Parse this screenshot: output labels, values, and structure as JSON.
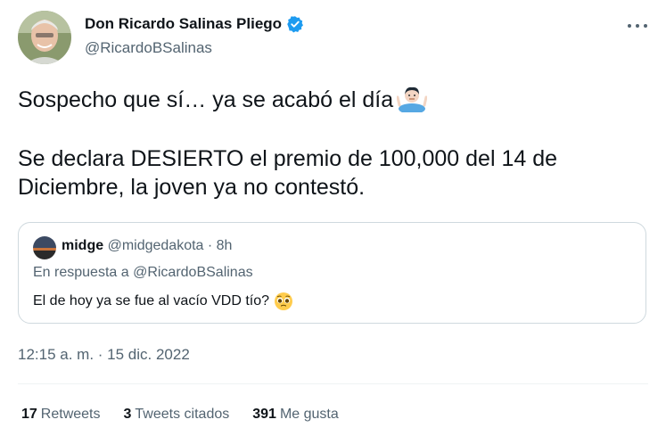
{
  "tweet": {
    "author_name": "Don Ricardo Salinas Pliego",
    "author_handle": "@RicardoBSalinas",
    "verified": true,
    "paragraph_1": "Sospecho que sí… ya se acabó el día",
    "paragraph_2": "Se declara DESIERTO el premio de 100,000 del 14 de Diciembre, la joven ya no contestó.",
    "timestamp": "12:15 a. m. · 15 dic. 2022"
  },
  "quoted": {
    "name": "midge",
    "handle_time": "@midgedakota · 8h",
    "reply_to": "En respuesta a @RicardoBSalinas",
    "text": "El de hoy ya se fue al vacío VDD tío?"
  },
  "stats": [
    {
      "count": "17",
      "label": "Retweets"
    },
    {
      "count": "3",
      "label": "Tweets citados"
    },
    {
      "count": "391",
      "label": "Me gusta"
    }
  ],
  "icons": {
    "verified_badge": "verified-badge-icon",
    "more": "more-options-icon",
    "shrug": "man-shrugging-emoji-icon",
    "pleading": "pleading-face-emoji-icon"
  },
  "colors": {
    "verified_blue": "#1d9bf0",
    "secondary_text": "#536471",
    "primary_text": "#0f1419",
    "border": "#cfd9de"
  }
}
